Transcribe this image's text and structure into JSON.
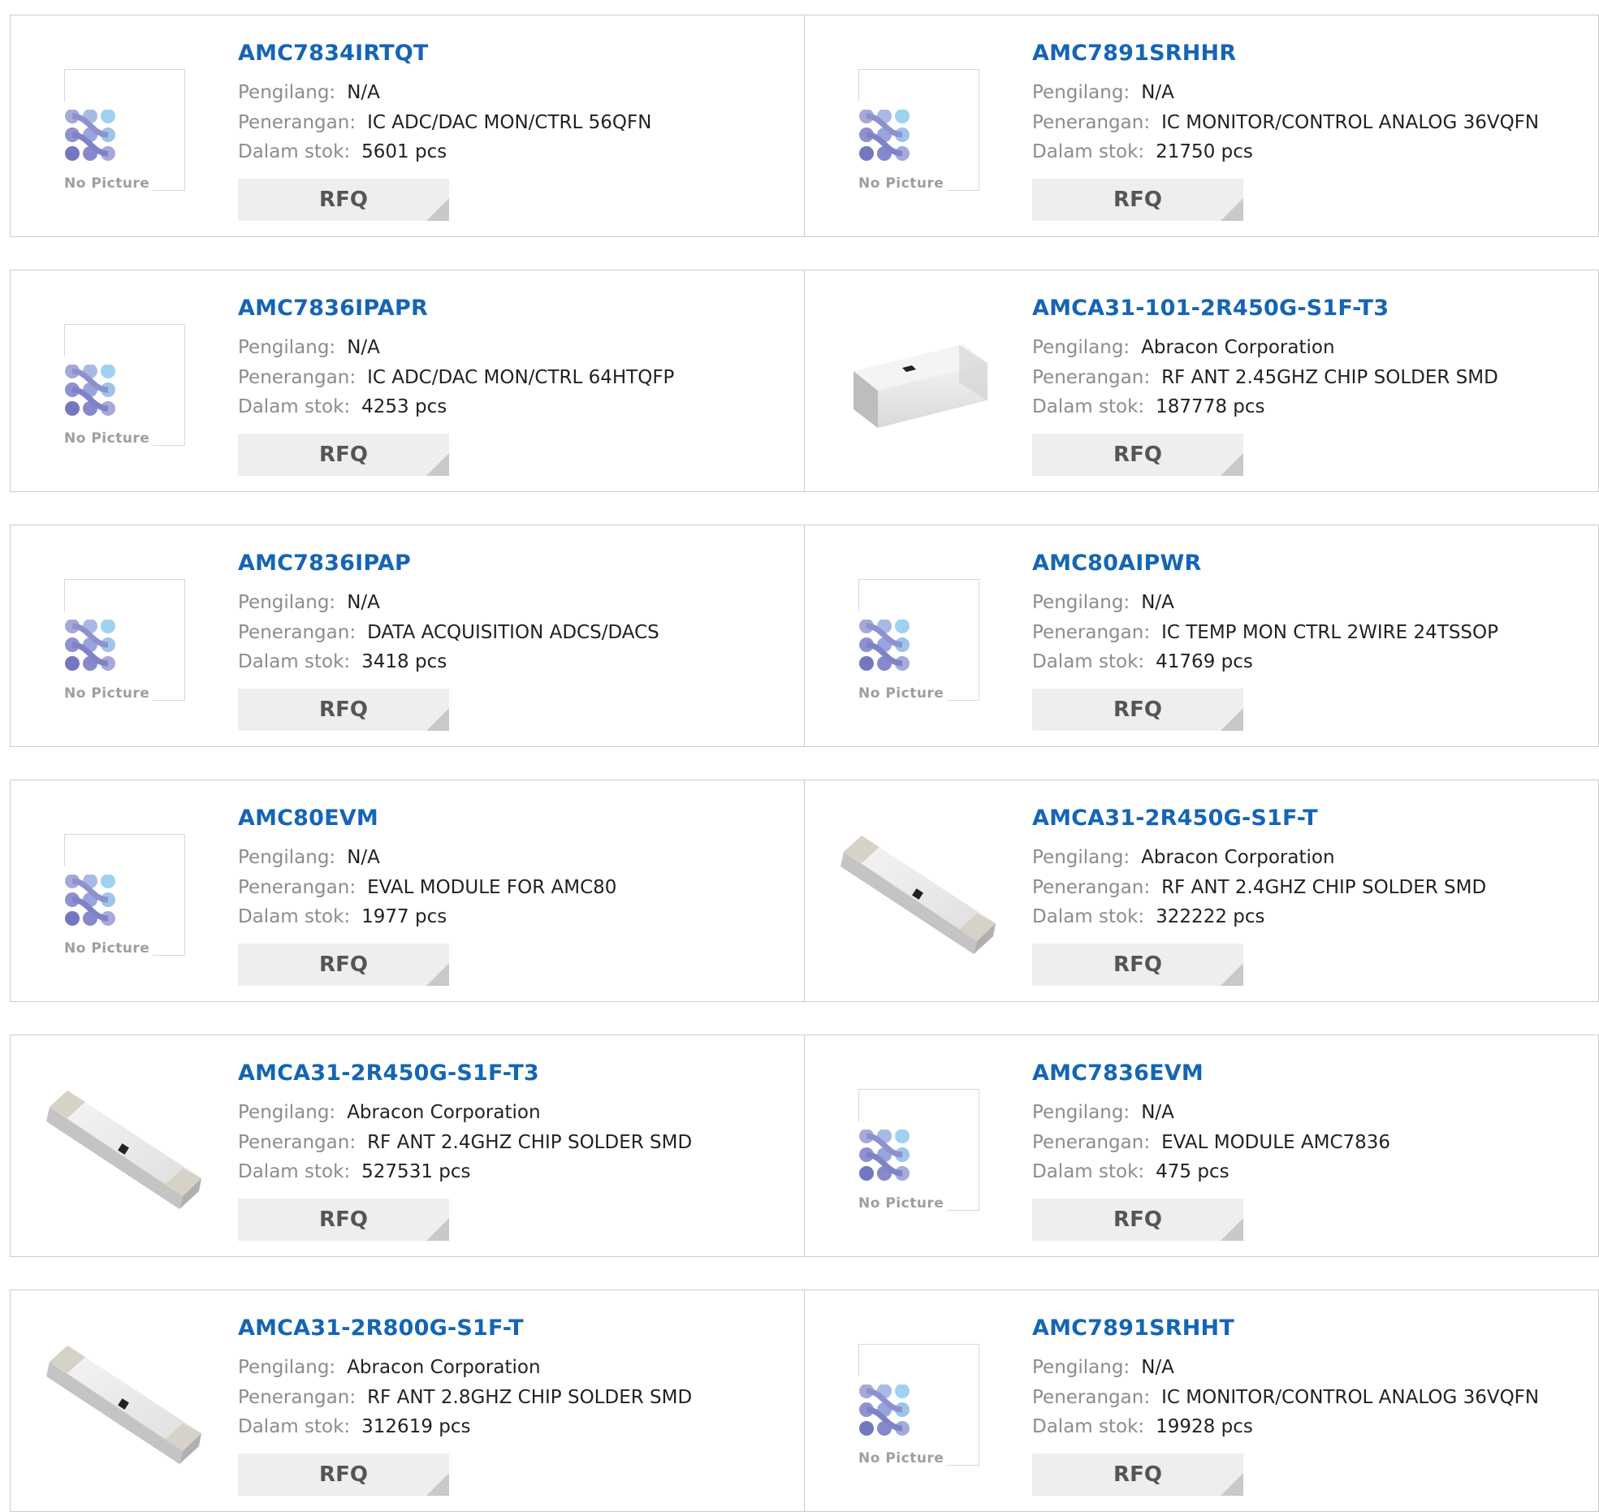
{
  "labels": {
    "manufacturer": "Pengilang:",
    "description": "Penerangan:",
    "stock": "Dalam stok:",
    "rfq": "RFQ",
    "no_picture": "No Picture"
  },
  "colors": {
    "part_link": "#1565b4",
    "label": "#8c8c8c",
    "value": "#222222",
    "rfq_bg": "#eeeeee",
    "border": "#cccccc"
  },
  "products": [
    {
      "part": "AMC7834IRTQT",
      "manufacturer": "N/A",
      "description": "IC ADC/DAC MON/CTRL 56QFN",
      "stock": "5601 pcs",
      "image": "no-picture"
    },
    {
      "part": "AMC7891SRHHR",
      "manufacturer": "N/A",
      "description": "IC MONITOR/CONTROL ANALOG 36VQFN",
      "stock": "21750 pcs",
      "image": "no-picture"
    },
    {
      "part": "AMC7836IPAPR",
      "manufacturer": "N/A",
      "description": "IC ADC/DAC MON/CTRL 64HTQFP",
      "stock": "4253 pcs",
      "image": "no-picture"
    },
    {
      "part": "AMCA31-101-2R450G-S1F-T3",
      "manufacturer": "Abracon Corporation",
      "description": "RF ANT 2.45GHZ CHIP SOLDER SMD",
      "stock": "187778 pcs",
      "image": "chip-short"
    },
    {
      "part": "AMC7836IPAP",
      "manufacturer": "N/A",
      "description": "DATA ACQUISITION ADCS/DACS",
      "stock": "3418 pcs",
      "image": "no-picture"
    },
    {
      "part": "AMC80AIPWR",
      "manufacturer": "N/A",
      "description": "IC TEMP MON CTRL 2WIRE 24TSSOP",
      "stock": "41769 pcs",
      "image": "no-picture"
    },
    {
      "part": "AMC80EVM",
      "manufacturer": "N/A",
      "description": "EVAL MODULE FOR AMC80",
      "stock": "1977 pcs",
      "image": "no-picture"
    },
    {
      "part": "AMCA31-2R450G-S1F-T",
      "manufacturer": "Abracon Corporation",
      "description": "RF ANT 2.4GHZ CHIP SOLDER SMD",
      "stock": "322222 pcs",
      "image": "chip-long"
    },
    {
      "part": "AMCA31-2R450G-S1F-T3",
      "manufacturer": "Abracon Corporation",
      "description": "RF ANT 2.4GHZ CHIP SOLDER SMD",
      "stock": "527531 pcs",
      "image": "chip-long"
    },
    {
      "part": "AMC7836EVM",
      "manufacturer": "N/A",
      "description": "EVAL MODULE AMC7836",
      "stock": "475 pcs",
      "image": "no-picture"
    },
    {
      "part": "AMCA31-2R800G-S1F-T",
      "manufacturer": "Abracon Corporation",
      "description": "RF ANT 2.8GHZ CHIP SOLDER SMD",
      "stock": "312619 pcs",
      "image": "chip-long"
    },
    {
      "part": "AMC7891SRHHT",
      "manufacturer": "N/A",
      "description": "IC MONITOR/CONTROL ANALOG 36VQFN",
      "stock": "19928 pcs",
      "image": "no-picture"
    }
  ]
}
